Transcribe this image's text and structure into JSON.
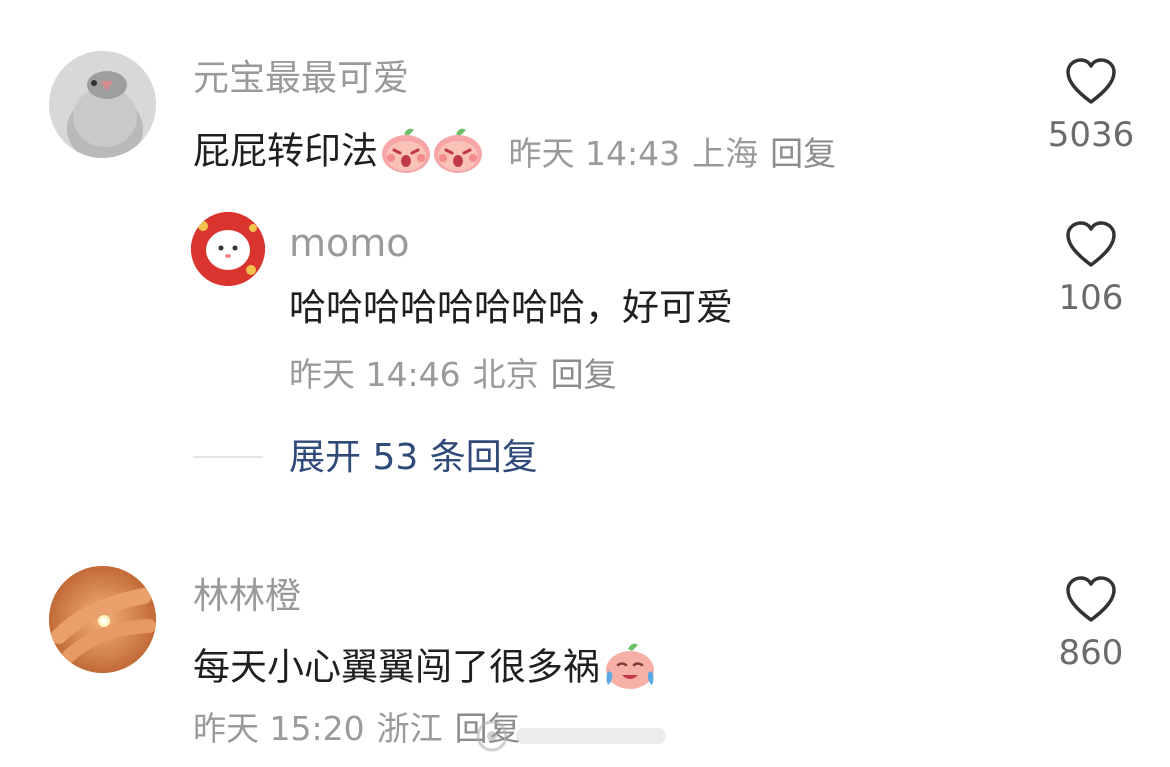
{
  "comments": [
    {
      "username": "元宝最最可爱",
      "text": "屁屁转印法",
      "emoji_count": 2,
      "time": "昨天 14:43",
      "location": "上海",
      "reply_label": "回复",
      "likes": "5036",
      "icon": "heart-outline-icon"
    },
    {
      "username": "林林橙",
      "text": "每天小心翼翼闯了很多祸",
      "emoji_count": 1,
      "time": "昨天 15:20",
      "location": "浙江",
      "reply_label": "回复",
      "likes": "860",
      "icon": "heart-outline-icon"
    }
  ],
  "reply": {
    "username": "momo",
    "text": "哈哈哈哈哈哈哈哈，好可爱",
    "time": "昨天 14:46",
    "location": "北京",
    "reply_label": "回复",
    "likes": "106"
  },
  "expand": {
    "label": "展开 53 条回复"
  },
  "colors": {
    "link": "#2f4a79",
    "meta": "#9a9a9a",
    "text": "#1f1f1f"
  }
}
